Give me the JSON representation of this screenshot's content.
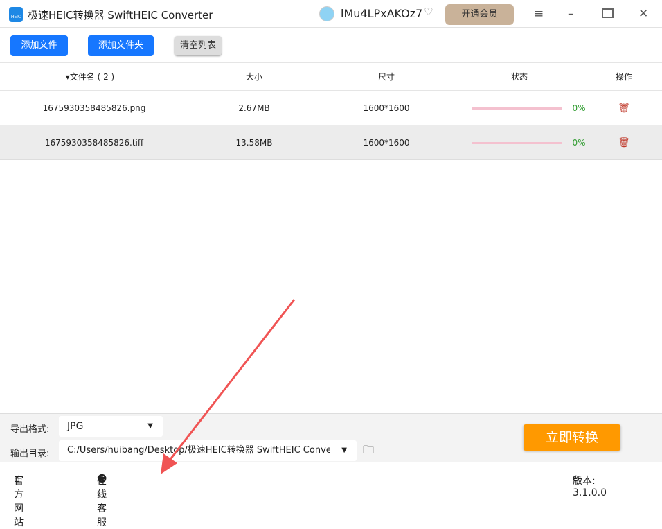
{
  "app": {
    "title": "极速HEIC转换器 SwiftHEIC Converter",
    "logo_text": "HEIC",
    "username": "lMu4LPxAKOz7",
    "vip_button": "开通会员"
  },
  "toolbar": {
    "add_file": "添加文件",
    "add_folder": "添加文件夹",
    "clear_list": "清空列表"
  },
  "table": {
    "headers": {
      "name": "▾文件名 ( 2 )",
      "size": "大小",
      "dimensions": "尺寸",
      "status": "状态",
      "action": "操作"
    },
    "rows": [
      {
        "name": "1675930358485826.png",
        "size": "2.67MB",
        "dimensions": "1600*1600",
        "progress": "0%"
      },
      {
        "name": "1675930358485826.tiff",
        "size": "13.58MB",
        "dimensions": "1600*1600",
        "progress": "0%"
      }
    ]
  },
  "output": {
    "format_label": "导出格式:",
    "format_value": "JPG",
    "dir_label": "输出目录:",
    "dir_value": "C:/Users/huibang/Desktop/极速HEIC转换器 SwiftHEIC Converter",
    "convert_button": "立即转换"
  },
  "footer": {
    "website": "官方网站",
    "support": "在线客服",
    "version": "版本: 3.1.0.0"
  },
  "colors": {
    "primary": "#1677ff",
    "convert": "#ff9900",
    "vip": "#c9b299",
    "annotation": "#f05454"
  }
}
